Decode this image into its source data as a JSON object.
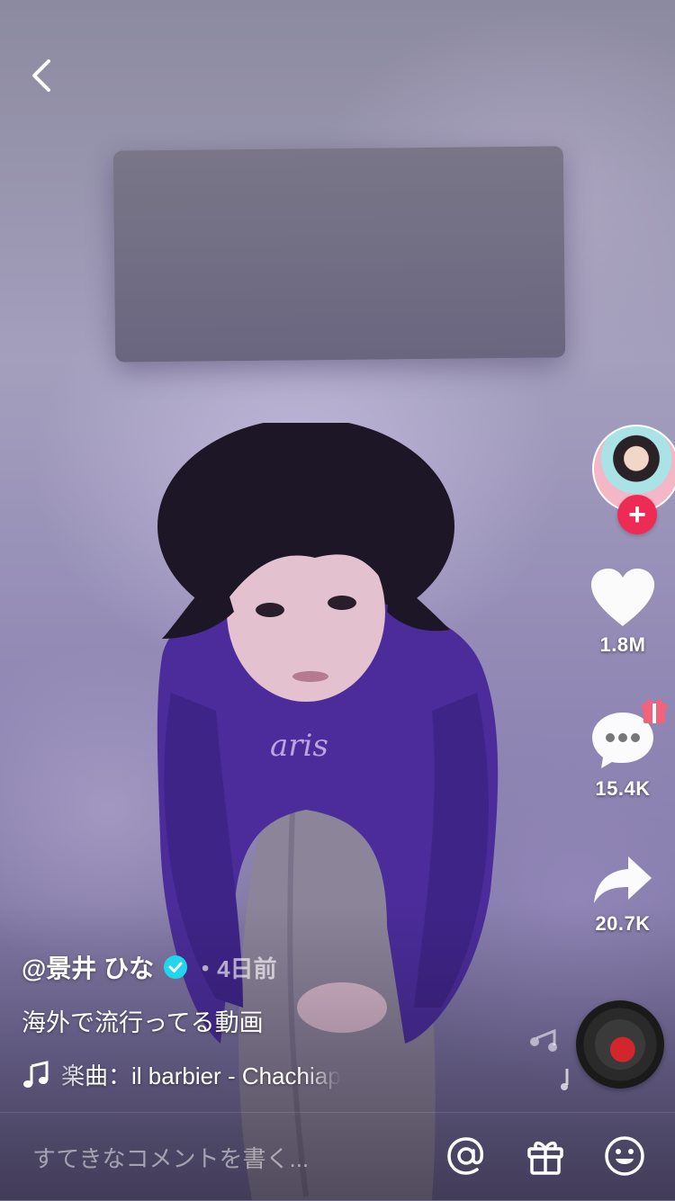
{
  "video": {
    "author": "@景井 ひな",
    "time": "・4日前",
    "description": "海外で流行ってる動画",
    "music": "楽曲：il barbier - Chachiap"
  },
  "actions": {
    "likes": "1.8M",
    "comments": "15.4K",
    "shares": "20.7K"
  },
  "comment_bar": {
    "placeholder": "すてきなコメントを書く..."
  },
  "icons": {
    "back": "chevron-left-icon",
    "follow": "plus-icon",
    "like": "heart-icon",
    "comment": "comment-bubble-icon",
    "gift_badge": "gift-icon",
    "share": "share-arrow-icon",
    "verified": "verified-check-icon",
    "music": "music-note-icon",
    "mention": "at-sign-icon",
    "gift": "gift-icon",
    "emoji": "smiley-icon"
  },
  "colors": {
    "follow_button": "#ee2b55",
    "verified_badge": "#20d5ec",
    "gift_badge": "#f2627a"
  }
}
